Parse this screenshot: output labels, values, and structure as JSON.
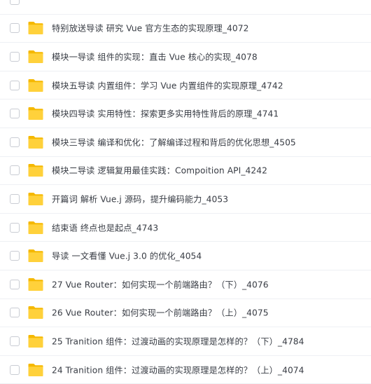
{
  "folder_icon": "folder-icon",
  "colors": {
    "folder_back": "#f5b800",
    "folder_front": "#ffd13b",
    "text": "#383c44",
    "divider": "#eef0f4"
  },
  "files": [
    {
      "name": "特别放送导读 研究 Vue 官方生态的实现原理_4072"
    },
    {
      "name": "模块一导读 组件的实现：直击 Vue 核心的实现_4078"
    },
    {
      "name": "模块五导读 内置组件：学习 Vue 内置组件的实现原理_4742"
    },
    {
      "name": "模块四导读 实用特性：探索更多实用特性背后的原理_4741"
    },
    {
      "name": "模块三导读 编译和优化：了解编译过程和背后的优化思想_4505"
    },
    {
      "name": "模块二导读 逻辑复用最佳实践：Compoition API_4242"
    },
    {
      "name": "开篇词 解析 Vue.j 源码，提升编码能力_4053"
    },
    {
      "name": "结束语 终点也是起点_4743"
    },
    {
      "name": "导读 一文看懂 Vue.j 3.0 的优化_4054"
    },
    {
      "name": "27 Vue Router：如何实现一个前端路由？（下）_4076"
    },
    {
      "name": "26 Vue Router：如何实现一个前端路由？（上）_4075"
    },
    {
      "name": "25 Tranition 组件：过渡动画的实现原理是怎样的？（下）_4784"
    },
    {
      "name": "24 Tranition 组件：过渡动画的实现原理是怎样的？（上）_4074"
    }
  ]
}
